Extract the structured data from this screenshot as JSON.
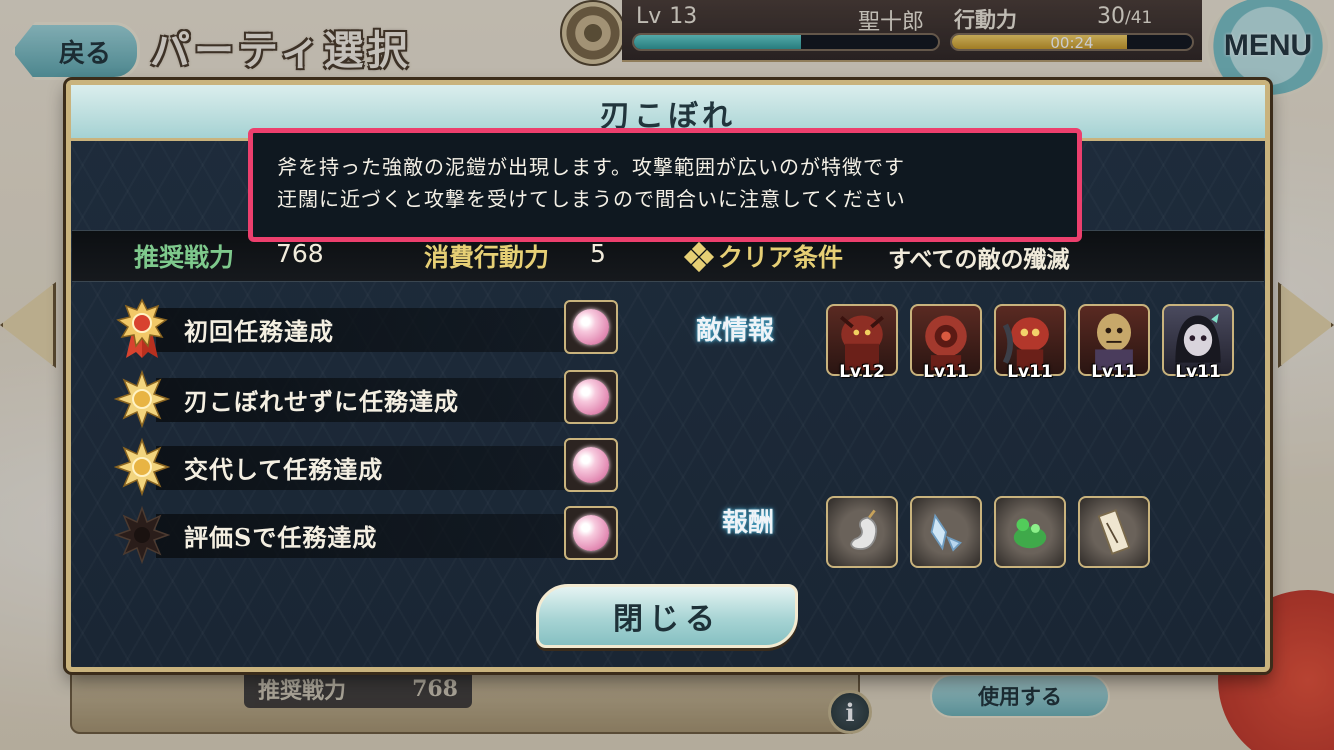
{
  "header": {
    "back_label": "戻る",
    "screen_title": "パーティ選択",
    "level_prefix": "Lv",
    "level": "13",
    "player_name": "聖十郎",
    "ap_label": "行動力",
    "ap_current": "30",
    "ap_max": "/41",
    "ap_timer": "00:24",
    "exp_fraction": 0.55,
    "ap_fraction": 0.73,
    "menu_label": "MENU"
  },
  "modal": {
    "title": "刃こぼれ",
    "description": [
      "斧を持った強敵の泥鎧が出現します。攻撃範囲が広いのが特徴です",
      "迂闊に近づくと攻撃を受けてしまうので間合いに注意してください"
    ],
    "recommended_power_label": "推奨戦力",
    "recommended_power_value": "768",
    "ap_cost_label": "消費行動力",
    "ap_cost_value": "5",
    "clear_condition_label": "クリア条件",
    "clear_condition_value": "すべての敵の殲滅",
    "missions": [
      {
        "label": "初回任務達成",
        "medal": "gold-medal-ribbon",
        "achieved": true
      },
      {
        "label": "刃こぼれせずに任務達成",
        "medal": "gold-star-medal",
        "achieved": true
      },
      {
        "label": "交代して任務達成",
        "medal": "gold-star-medal",
        "achieved": true
      },
      {
        "label": "評価Sで任務達成",
        "medal": "dark-star-medal",
        "achieved": false
      }
    ],
    "enemy_info_label": "敵情報",
    "enemies": [
      {
        "icon": "armored-enemy-icon",
        "level": "Lv12"
      },
      {
        "icon": "armored-enemy-icon",
        "level": "Lv11"
      },
      {
        "icon": "armored-enemy-icon",
        "level": "Lv11"
      },
      {
        "icon": "masked-enemy-icon",
        "level": "Lv11"
      },
      {
        "icon": "girl-enemy-icon",
        "level": "Lv11"
      }
    ],
    "rewards_label": "報酬",
    "rewards": [
      {
        "icon": "magatama-icon"
      },
      {
        "icon": "blade-shard-icon"
      },
      {
        "icon": "green-stone-icon"
      },
      {
        "icon": "scroll-icon"
      }
    ],
    "close_label": "閉じる"
  },
  "background": {
    "recommended_power_label": "推奨戦力",
    "recommended_power_value": "768",
    "use_button_label": "使用する",
    "info_label": "i"
  },
  "colors": {
    "highlight_border": "#ec3f6d",
    "frame_gold": "#c9b37d",
    "panel_navy": "#1e2c3c",
    "accent_teal": "#a5d2d3"
  }
}
